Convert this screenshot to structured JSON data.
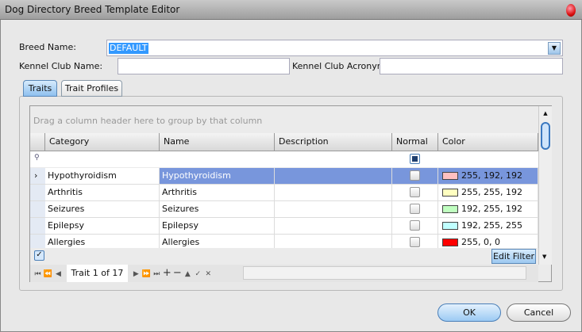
{
  "window": {
    "title": "Dog Directory Breed Template Editor"
  },
  "form": {
    "breed_name_label": "Breed Name:",
    "breed_name_value": "DEFAULT",
    "kennel_club_name_label": "Kennel Club Name:",
    "kennel_club_name_value": "",
    "kennel_club_acronym_label": "Kennel Club Acronym:",
    "kennel_club_acronym_value": ""
  },
  "tabs": [
    {
      "label": "Traits",
      "active": true
    },
    {
      "label": "Trait Profiles",
      "active": false
    }
  ],
  "grid": {
    "group_panel_text": "Drag a column header here to group by that column",
    "columns": [
      "Category",
      "Name",
      "Description",
      "Normal",
      "Color"
    ],
    "rows": [
      {
        "category": "Hypothyroidism",
        "name": "Hypothyroidism",
        "description": "",
        "normal": false,
        "color_text": "255, 192, 192",
        "color": "#ffc0c0",
        "selected": true
      },
      {
        "category": "Arthritis",
        "name": "Arthritis",
        "description": "",
        "normal": false,
        "color_text": "255, 255, 192",
        "color": "#ffffc0"
      },
      {
        "category": "Seizures",
        "name": "Seizures",
        "description": "",
        "normal": false,
        "color_text": "192, 255, 192",
        "color": "#c0ffc0"
      },
      {
        "category": "Epilepsy",
        "name": "Epilepsy",
        "description": "",
        "normal": false,
        "color_text": "192, 255, 255",
        "color": "#c0ffff"
      },
      {
        "category": "Allergies",
        "name": "Allergies",
        "description": "",
        "normal": false,
        "color_text": "255, 0, 0",
        "color": "#ff0000"
      }
    ],
    "edit_filter_label": "Edit Filter",
    "record_text": "Trait 1 of 17"
  },
  "buttons": {
    "ok": "OK",
    "cancel": "Cancel"
  }
}
